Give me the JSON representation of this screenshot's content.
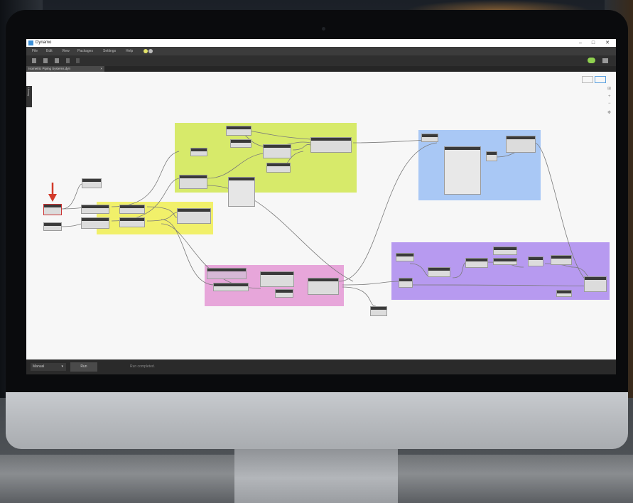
{
  "window": {
    "title": "Dynamo",
    "controls": [
      "–",
      "□",
      "✕"
    ]
  },
  "menu": {
    "items": [
      "File",
      "Edit",
      "View",
      "Packages",
      "Settings",
      "Help"
    ]
  },
  "tab": {
    "label": "Isometric Piping Systems.dyn",
    "close": "×"
  },
  "library_label": "Library",
  "canvas_controls": {
    "zoom_in": "+",
    "zoom_out": "−",
    "fit": "⊞",
    "pan": "✥"
  },
  "bottom": {
    "run_mode": "Manual",
    "run_button": "Run",
    "status": "Run completed."
  },
  "colors": {
    "group_green": "#d7ea6a",
    "group_yellow": "#f1f06a",
    "group_blue": "#a9c8f5",
    "group_purple": "#b79af0",
    "group_pink": "#e7a6da",
    "highlight_arrow": "#d23a2a"
  }
}
